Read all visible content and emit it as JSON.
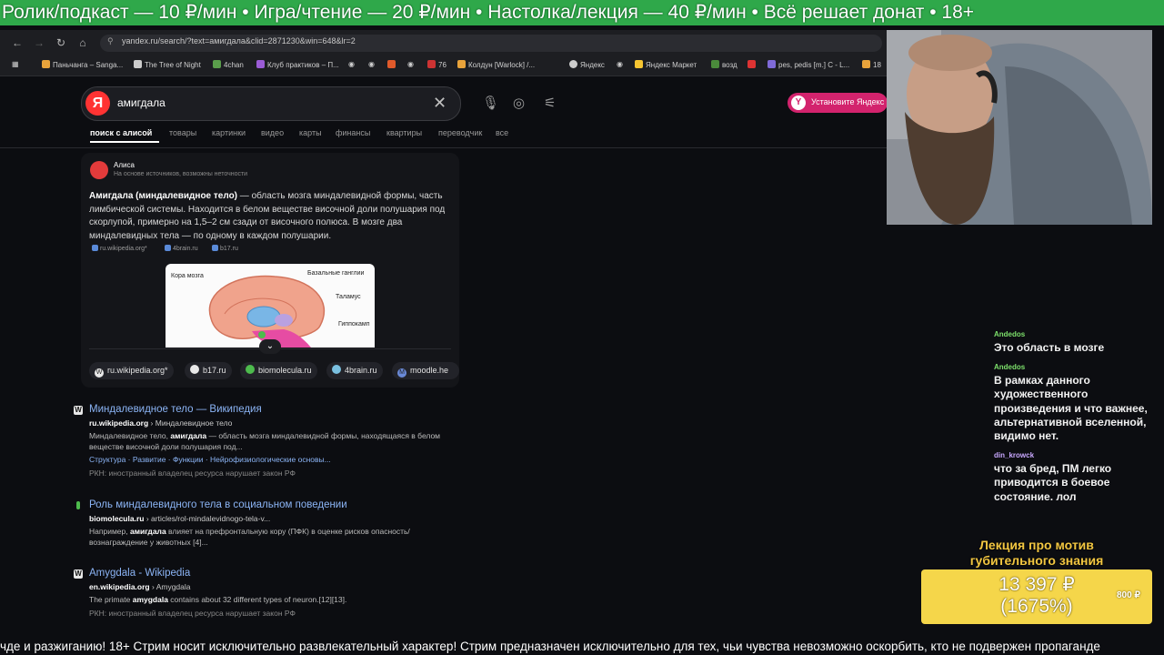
{
  "ticker_top": "Ролик/подкаст — 10 ₽/мин • Игра/чтение — 20 ₽/мин • Настолка/лекция — 40 ₽/мин • Всё решает донат • 18+",
  "browser": {
    "url": "yandex.ru/search/?text=амигдала&clid=2871230&win=648&lr=2",
    "bookmarks": [
      "Паньчанга – Sanga...",
      "The Tree of Night",
      "4chan",
      "Клуб практиков – П...",
      "76",
      "Колдун [Warlock] /...",
      "Яндекс",
      "Яндекс Маркет",
      "возд",
      "pes, pedis [m.] C - L...",
      "18"
    ]
  },
  "search": {
    "query": "амигдала",
    "install_label": "Установите Яндекс",
    "tabs": [
      "поиск с алисой",
      "товары",
      "картинки",
      "видео",
      "карты",
      "финансы",
      "квартиры",
      "переводчик",
      "все"
    ]
  },
  "alice": {
    "name": "Алиса",
    "subtitle": "На основе источников, возможны неточности",
    "term": "Амигдала (миндалевидное тело)",
    "text": " — область мозга миндалевидной формы, часть лимбической системы. Находится в белом веществе височной доли полушария под скорлупой, примерно на 1,5–2 см сзади от височного полюса. В мозге два миндалевидных тела — по одному в каждом полушарии.",
    "sources": [
      "ru.wikipedia.org*",
      "4brain.ru",
      "b17.ru"
    ],
    "image_labels": [
      "Кора мозга",
      "Базальные ганглии",
      "Таламус",
      "Гиппокамп"
    ],
    "chips": [
      "ru.wikipedia.org*",
      "b17.ru",
      "biomolecula.ru",
      "4brain.ru",
      "moodle.he"
    ]
  },
  "results": [
    {
      "title": "Миндалевидное тело — Википедия",
      "url_domain": "ru.wikipedia.org",
      "url_path": " › Миндалевидное тело",
      "snippet_pre": "Миндалевидное тело, ",
      "snippet_bold": "амигдала",
      "snippet_post": " — область мозга миндалевидной формы, находящаяся в белом веществе височной доли полушария под...",
      "links": "Структура · Развитие · Функции · Нейрофизиологические основы...",
      "note": "РКН: иностранный владелец ресурса нарушает закон РФ"
    },
    {
      "title": "Роль миндалевидного тела в социальном поведении",
      "url_domain": "biomolecula.ru",
      "url_path": " › articles/rol-mindalevidnogo-tela-v...",
      "snippet_pre": "Например, ",
      "snippet_bold": "амигдала",
      "snippet_post": " влияет на префронтальную кору (ПФК) в оценке рисков опасность/вознаграждение у животных [4]..."
    },
    {
      "title": "Amygdala - Wikipedia",
      "url_domain": "en.wikipedia.org",
      "url_path": " › Amygdala",
      "snippet_pre": "The primate ",
      "snippet_bold": "amygdala",
      "snippet_post": " contains about 32 different types of neuron.[12][13].",
      "note": "РКН: иностранный владелец ресурса нарушает закон РФ"
    }
  ],
  "chat": [
    {
      "user": "Andedos",
      "color": "#7de06b",
      "text": "Это область в мозге"
    },
    {
      "user": "Andedos",
      "color": "#7de06b",
      "text": "В рамках данного художественного произведения и что важнее, альтернативной вселенной, видимо нет."
    },
    {
      "user": "din_krowck",
      "color": "#c9a8ff",
      "text": "что за бред, ПМ легко приводится в боевое состояние. лол"
    }
  ],
  "donation": {
    "title": "Лекция про мотив губительного знания",
    "amount": "13 397 ₽",
    "percent": "(1675%)",
    "goal": "800 ₽",
    "fraction": 16.75
  },
  "ticker_bottom": "чде и разжиганию! 18+ Стрим носит исключительно развлекательный характер! Стрим предназначен исключительно для тех, чьи чувства невозможно оскорбить, кто не подвержен пропаганде"
}
